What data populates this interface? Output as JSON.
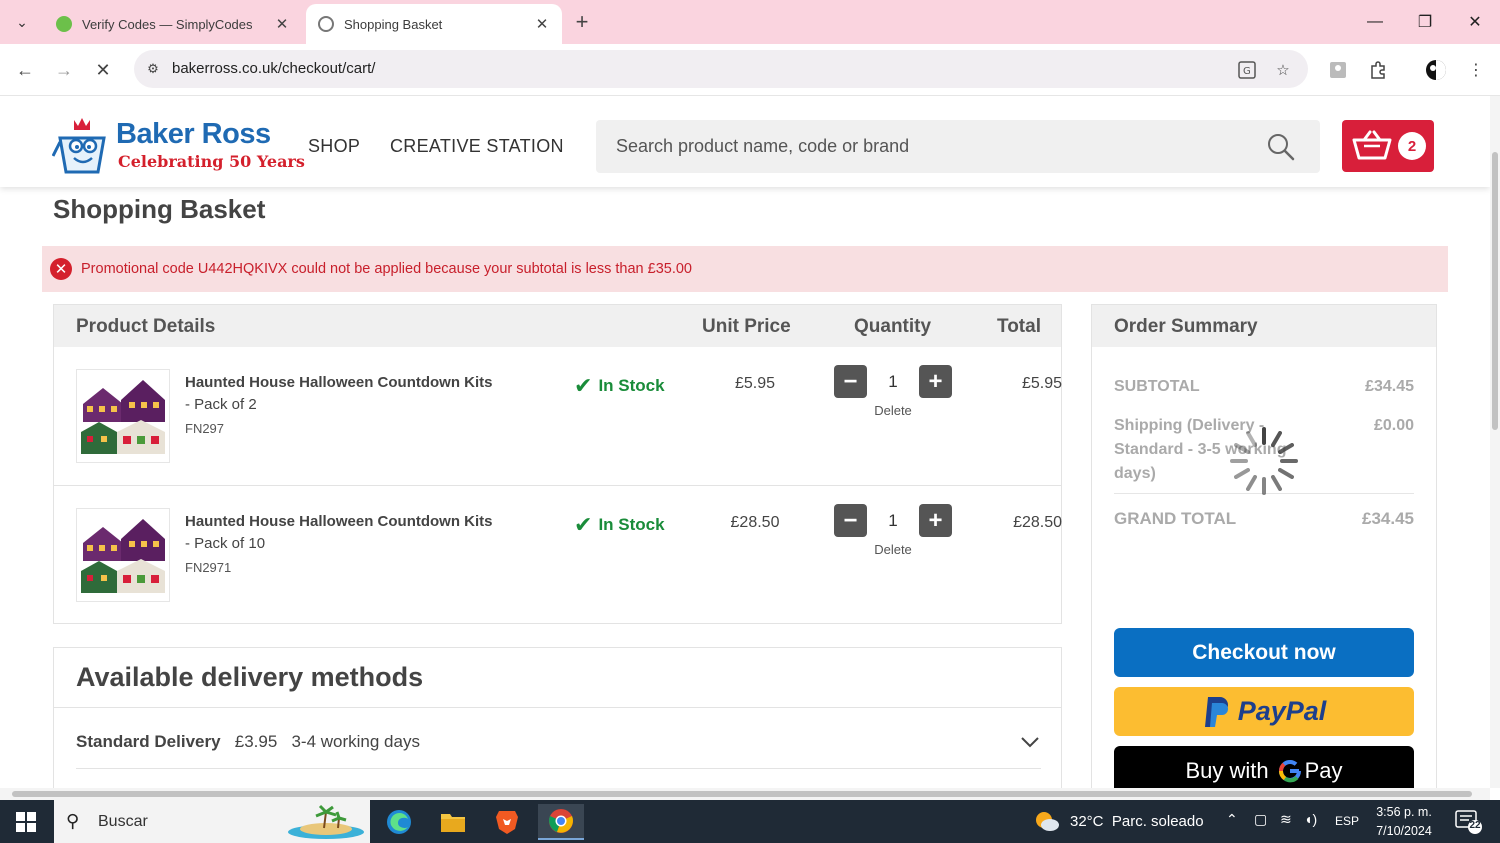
{
  "browser": {
    "tabs": [
      {
        "title": "Verify Codes — SimplyCodes"
      },
      {
        "title": "Shopping Basket"
      }
    ],
    "url": "bakerross.co.uk/checkout/cart/"
  },
  "header": {
    "brand": "Baker Ross",
    "tagline": "Celebrating 50 Years",
    "nav": [
      "SHOP",
      "CREATIVE STATION"
    ],
    "search_placeholder": "Search product name, code or brand",
    "basket_count": "2"
  },
  "page_title": "Shopping Basket",
  "alert": {
    "message": "Promotional code U442HQKIVX could not be applied because your subtotal is less than £35.00"
  },
  "cart": {
    "columns": [
      "Product Details",
      "Unit Price",
      "Quantity",
      "Total"
    ],
    "items": [
      {
        "name": "Haunted House Halloween Countdown Kits",
        "pack": "- Pack of 2",
        "code": "FN297",
        "stock": "In Stock",
        "unit_price": "£5.95",
        "quantity": "1",
        "delete": "Delete",
        "total": "£5.95"
      },
      {
        "name": "Haunted House Halloween Countdown Kits",
        "pack": "- Pack of 10",
        "code": "FN2971",
        "stock": "In Stock",
        "unit_price": "£28.50",
        "quantity": "1",
        "delete": "Delete",
        "total": "£28.50"
      }
    ]
  },
  "delivery": {
    "title": "Available delivery methods",
    "methods": [
      {
        "name": "Standard Delivery",
        "price": "£3.95",
        "time": "3-4 working days"
      }
    ]
  },
  "summary": {
    "title": "Order Summary",
    "subtotal_label": "SUBTOTAL",
    "subtotal": "£34.45",
    "shipping_label_1": "Shipping (Delivery -",
    "shipping_label_2": "Standard - 3-5 working",
    "shipping_label_3": "days)",
    "shipping": "£0.00",
    "grand_total_label": "GRAND TOTAL",
    "grand_total": "£34.45",
    "checkout_label": "Checkout now",
    "paypal_label": "PayPal",
    "gpay_prefix": "Buy with",
    "gpay_suffix": "Pay"
  },
  "taskbar": {
    "search_label": "Buscar",
    "weather": "32°C  Parc. soleado",
    "language": "ESP",
    "time": "3:56 p. m.",
    "date": "7/10/2024",
    "notifications": "22"
  },
  "colors": {
    "brand_blue": "#1f6ab3",
    "brand_red": "#d81f3a",
    "stock_green": "#1a8c3a",
    "checkout_blue": "#0a6fc2",
    "paypal_yellow": "#fcbd31"
  }
}
